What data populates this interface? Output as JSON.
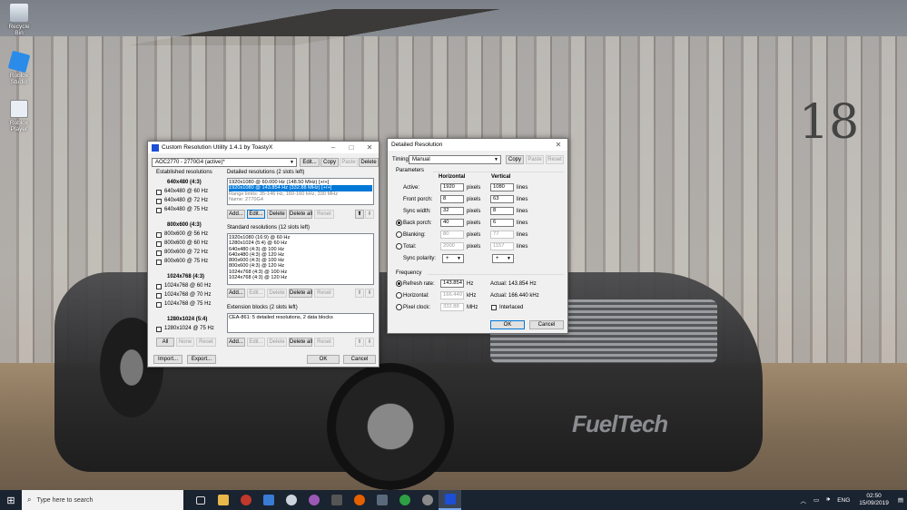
{
  "desktop": {
    "icons": [
      {
        "label": "Recycle Bin",
        "icon": "recycle-bin-icon"
      },
      {
        "label": "Roblox Studio",
        "icon": "roblox-studio-icon"
      },
      {
        "label": "Roblox Player",
        "icon": "roblox-player-icon"
      }
    ],
    "wallpaper_text": {
      "brand": "FuelTech",
      "numeral": "18"
    }
  },
  "cru": {
    "title": "Custom Resolution Utility 1.4.1 by ToastyX",
    "monitor": "AOC2770 - 2770G4 (active)*",
    "top_buttons": {
      "edit": "Edit...",
      "copy": "Copy",
      "paste": "Paste",
      "delete": "Delete"
    },
    "established": {
      "heading": "Established resolutions",
      "groups": [
        {
          "title": "640x480 (4:3)",
          "items": [
            {
              "label": "640x480 @ 60 Hz"
            },
            {
              "label": "640x480 @ 72 Hz"
            },
            {
              "label": "640x480 @ 75 Hz"
            }
          ]
        },
        {
          "title": "800x600 (4:3)",
          "items": [
            {
              "label": "800x600 @ 56 Hz"
            },
            {
              "label": "800x600 @ 60 Hz"
            },
            {
              "label": "800x600 @ 72 Hz"
            },
            {
              "label": "800x600 @ 75 Hz"
            }
          ]
        },
        {
          "title": "1024x768 (4:3)",
          "items": [
            {
              "label": "1024x768 @ 60 Hz"
            },
            {
              "label": "1024x768 @ 70 Hz"
            },
            {
              "label": "1024x768 @ 75 Hz"
            }
          ]
        },
        {
          "title": "1280x1024 (5:4)",
          "items": [
            {
              "label": "1280x1024 @ 75 Hz"
            }
          ]
        }
      ],
      "buttons": {
        "all": "All",
        "none": "None",
        "reset": "Reset"
      }
    },
    "detailed": {
      "heading": "Detailed resolutions (2 slots left)",
      "items": [
        "1920x1080 @ 60.000 Hz (148.50 MHz) [+/+]",
        "1920x1080 @ 143.854 Hz (332.88 MHz) [+/+]",
        "Range limits: 35-146 Hz, 160-160 kHz, 330 MHz",
        "Name: 2770G4"
      ],
      "buttons": {
        "add": "Add...",
        "edit": "Edit...",
        "delete": "Delete",
        "delete_all": "Delete all",
        "reset": "Reset"
      }
    },
    "standard": {
      "heading": "Standard resolutions (12 slots left)",
      "items": [
        "1920x1080 (16:9) @ 60 Hz",
        "1280x1024 (5:4) @ 60 Hz",
        "640x480 (4:3) @ 100 Hz",
        "640x480 (4:3) @ 120 Hz",
        "800x600 (4:3) @ 100 Hz",
        "800x600 (4:3) @ 120 Hz",
        "1024x768 (4:3) @ 100 Hz",
        "1024x768 (4:3) @ 120 Hz"
      ],
      "buttons": {
        "add": "Add...",
        "edit": "Edit...",
        "delete": "Delete",
        "delete_all": "Delete all",
        "reset": "Reset"
      }
    },
    "extension": {
      "heading": "Extension blocks (2 slots left)",
      "items": [
        "CEA-861: 5 detailed resolutions, 2 data blocks"
      ],
      "buttons": {
        "add": "Add...",
        "edit": "Edit...",
        "delete": "Delete",
        "delete_all": "Delete all",
        "reset": "Reset"
      }
    },
    "footer": {
      "import": "Import...",
      "export": "Export...",
      "ok": "OK",
      "cancel": "Cancel"
    }
  },
  "detail": {
    "title": "Detailed Resolution",
    "timing_label": "Timing:",
    "timing_value": "Manual",
    "copy": "Copy",
    "paste": "Paste",
    "reset": "Reset",
    "parameters": "Parameters",
    "horizontal": "Horizontal",
    "vertical": "Vertical",
    "rows": [
      {
        "label": "Active:",
        "h": "1920",
        "hunit": "pixels",
        "v": "1080",
        "vunit": "lines"
      },
      {
        "label": "Front porch:",
        "h": "8",
        "hunit": "pixels",
        "v": "63",
        "vunit": "lines"
      },
      {
        "label": "Sync width:",
        "h": "32",
        "hunit": "pixels",
        "v": "8",
        "vunit": "lines"
      },
      {
        "label": "Back porch:",
        "h": "40",
        "hunit": "pixels",
        "v": "6",
        "vunit": "lines"
      },
      {
        "label": "Blanking:",
        "h": "80",
        "hunit": "pixels",
        "v": "77",
        "vunit": "lines"
      },
      {
        "label": "Total:",
        "h": "2000",
        "hunit": "pixels",
        "v": "1157",
        "vunit": "lines"
      }
    ],
    "sync_polarity": "Sync polarity:",
    "sync_h": "+",
    "sync_v": "+",
    "frequency": "Frequency",
    "refresh_label": "Refresh rate:",
    "refresh_value": "143.854",
    "refresh_unit": "Hz",
    "refresh_actual": "Actual: 143.854 Hz",
    "horizontal_label": "Horizontal:",
    "horizontal_value": "166.440",
    "horizontal_unit": "kHz",
    "horizontal_actual": "Actual: 166.440 kHz",
    "pixel_label": "Pixel clock:",
    "pixel_value": "332.88",
    "pixel_unit": "MHz",
    "interlaced": "Interlaced",
    "ok": "OK",
    "cancel": "Cancel"
  },
  "taskbar": {
    "search_placeholder": "Type here to search",
    "language": "ENG",
    "time": "02:50",
    "date": "15/09/2019"
  }
}
